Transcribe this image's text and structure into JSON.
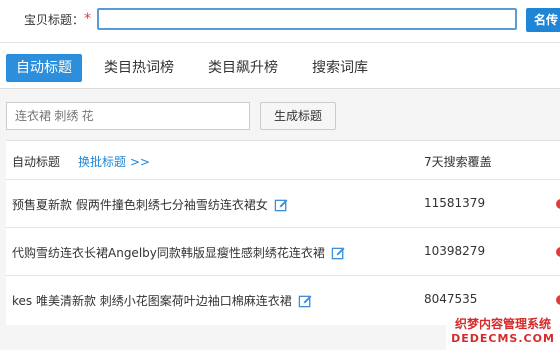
{
  "form": {
    "title_label": "宝贝标题：",
    "required_mark": "*",
    "title_value": "",
    "name_button": "名传"
  },
  "tabs": [
    {
      "label": "自动标题",
      "active": true
    },
    {
      "label": "类目热词榜",
      "active": false
    },
    {
      "label": "类目飙升榜",
      "active": false
    },
    {
      "label": "搜索词库",
      "active": false
    }
  ],
  "search": {
    "placeholder": "连衣裙 刺绣 花",
    "generate_label": "生成标题"
  },
  "table": {
    "headers": {
      "title": "自动标题",
      "batch_link": "换批标题 >>",
      "coverage": "7天搜索覆盖"
    },
    "rows": [
      {
        "title": "预售夏新款 假两件撞色刺绣七分袖雪纺连衣裙女",
        "coverage": "11581379"
      },
      {
        "title": "代购雪纺连衣长裙Angelby同款韩版显瘦性感刺绣花连衣裙",
        "coverage": "10398279"
      },
      {
        "title": "kes 唯美清新款 刺绣小花图案荷叶边袖口棉麻连衣裙",
        "coverage": "8047535"
      }
    ]
  },
  "watermark": {
    "line1": "织梦内容管理系统",
    "line2": "DEDECMS.COM"
  },
  "colors": {
    "accent": "#2d8fdb",
    "link": "#1f86d7",
    "required": "#e4393c"
  }
}
